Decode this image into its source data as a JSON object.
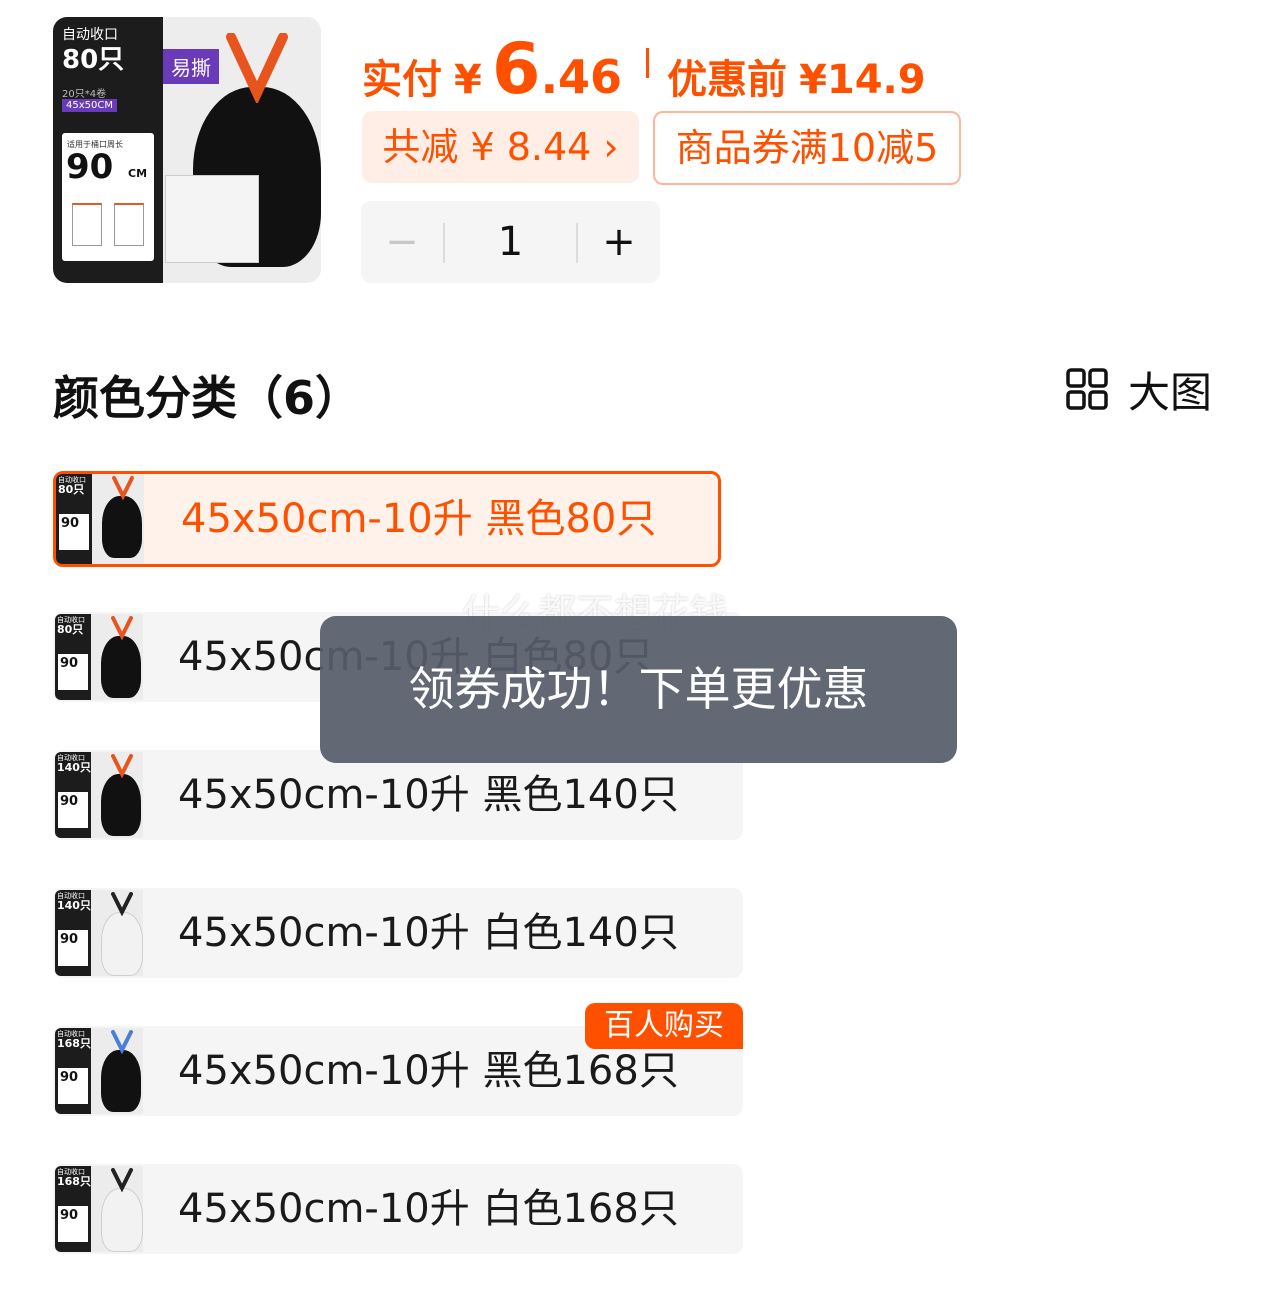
{
  "product": {
    "thumb": {
      "title": "自动收口",
      "count": "80只",
      "pack": "20只*4卷",
      "size": "45x50CM",
      "perimeter_label": "适用于桶口周长",
      "perimeter_value": "90",
      "perimeter_unit": "CM",
      "tag": "易撕"
    },
    "price": {
      "actual_label": "实付",
      "currency": "¥",
      "actual_int": "6",
      "actual_dec": ".46",
      "before_label": "优惠前",
      "before_value": "¥14.9"
    },
    "total_discount": "共减 ¥ 8.44 ›",
    "coupon": "商品券满10减5",
    "quantity": {
      "minus": "−",
      "value": "1",
      "plus": "+"
    }
  },
  "section": {
    "title": "颜色分类（6）",
    "bigview_label": "大图",
    "bigview_icon": "grid-icon"
  },
  "options": [
    {
      "label": "45x50cm-10升 黑色80只",
      "thumb_title": "自动收口",
      "thumb_count": "80只",
      "bag_color": "#111111",
      "tie_color": "#e8541e",
      "selected": true
    },
    {
      "label": "45x50cm-10升 白色80只",
      "thumb_title": "自动收口",
      "thumb_count": "80只",
      "bag_color": "#111111",
      "tie_color": "#e8541e",
      "selected": false
    },
    {
      "label": "45x50cm-10升 黑色140只",
      "thumb_title": "自动收口",
      "thumb_count": "140只",
      "bag_color": "#111111",
      "tie_color": "#e8541e",
      "selected": false
    },
    {
      "label": "45x50cm-10升 白色140只",
      "thumb_title": "自动收口",
      "thumb_count": "140只",
      "bag_color": "#f2f2f2",
      "tie_color": "#222222",
      "selected": false
    },
    {
      "label": "45x50cm-10升 黑色168只",
      "thumb_title": "自动收口",
      "thumb_count": "168只",
      "bag_color": "#111111",
      "tie_color": "#4a7fd6",
      "selected": false
    },
    {
      "label": "45x50cm-10升 白色168只",
      "thumb_title": "自动收口",
      "thumb_count": "168只",
      "bag_color": "#f2f2f2",
      "tie_color": "#222222",
      "selected": false
    }
  ],
  "badge": "百人购买",
  "toast": {
    "watermark": "什么都不想花钱",
    "message": "领券成功！下单更优惠"
  },
  "colors": {
    "accent": "#ff5000",
    "selected_bg": "#fff2ea",
    "option_bg": "#f5f5f5",
    "toast_bg": "#565c69"
  }
}
